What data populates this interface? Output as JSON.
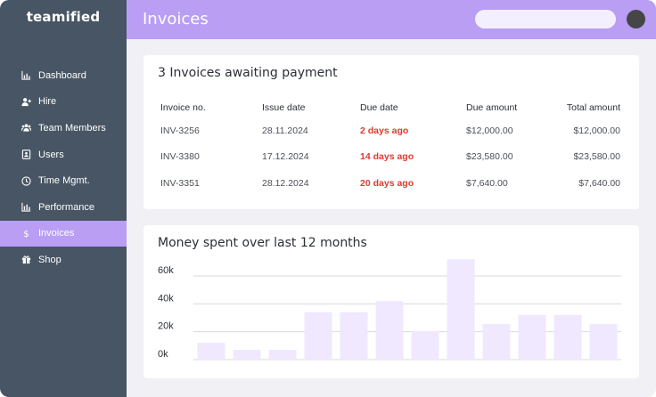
{
  "app": {
    "logo": "teamified"
  },
  "header": {
    "title": "Invoices",
    "search_placeholder": ""
  },
  "sidebar": {
    "items": [
      {
        "label": "Dashboard",
        "icon": "chart-icon"
      },
      {
        "label": "Hire",
        "icon": "add-user-icon"
      },
      {
        "label": "Team Members",
        "icon": "team-icon"
      },
      {
        "label": "Users",
        "icon": "user-card-icon"
      },
      {
        "label": "Time Mgmt.",
        "icon": "clock-icon"
      },
      {
        "label": "Performance",
        "icon": "bar-chart-icon"
      },
      {
        "label": "Invoices",
        "icon": "dollar-icon",
        "active": true
      },
      {
        "label": "Shop",
        "icon": "gift-icon"
      }
    ]
  },
  "invoices": {
    "title": "3 Invoices awaiting payment",
    "columns": [
      "Invoice no.",
      "Issue date",
      "Due date",
      "Due amount",
      "Total amount"
    ],
    "rows": [
      {
        "invoice_no": "INV-3256",
        "issue_date": "28.11.2024",
        "due_date": "2 days ago",
        "due_amount": "$12,000.00",
        "total_amount": "$12,000.00"
      },
      {
        "invoice_no": "INV-3380",
        "issue_date": "17.12.2024",
        "due_date": "14 days ago",
        "due_amount": "$23,580.00",
        "total_amount": "$23,580.00"
      },
      {
        "invoice_no": "INV-3351",
        "issue_date": "28.12.2024",
        "due_date": "20 days ago",
        "due_amount": "$7,640.00",
        "total_amount": "$7,640.00"
      }
    ],
    "due_color": "#e03a2f"
  },
  "colors": {
    "accent": "#b99ef4",
    "sidebar": "#475564",
    "bar": "#f0e8fe"
  },
  "chart_data": {
    "type": "bar",
    "title": "Money spent over last 12 months",
    "ylim": [
      0,
      60000
    ],
    "yticks": [
      {
        "value": 0,
        "label": "0k"
      },
      {
        "value": 20000,
        "label": "20k"
      },
      {
        "value": 40000,
        "label": "40k"
      },
      {
        "value": 60000,
        "label": "60k"
      }
    ],
    "values": [
      12000,
      7000,
      7000,
      34000,
      34000,
      42000,
      20500,
      72000,
      25500,
      32000,
      32000,
      25500
    ],
    "grid": true,
    "legend": "none"
  }
}
